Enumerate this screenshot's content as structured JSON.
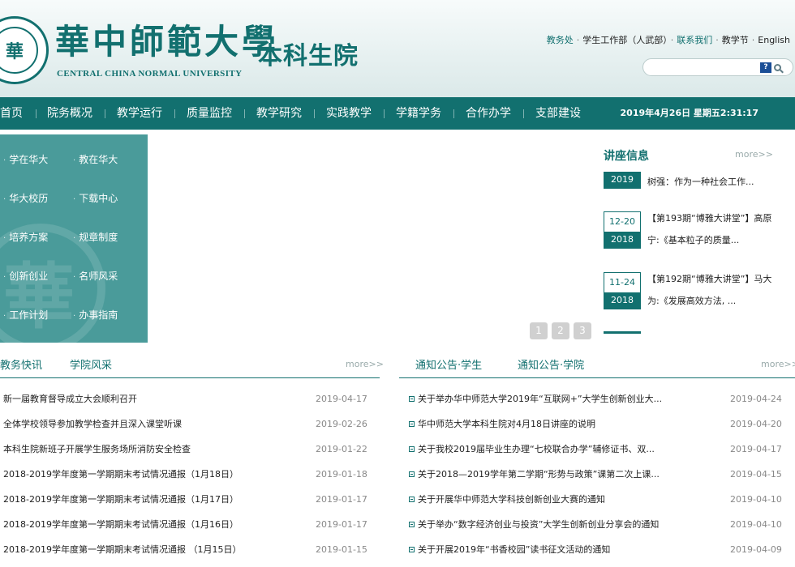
{
  "header": {
    "logo_title": "華中師範大學",
    "logo_subtitle": "CENTRAL CHINA NORMAL UNIVERSITY",
    "dept_name": "本科生院",
    "seal_glyph": "華",
    "top_links": [
      {
        "label": "教务处",
        "color": "#12706f"
      },
      {
        "label": "学生工作部（人武部）",
        "color": "#222222"
      },
      {
        "label": "联系我们",
        "color": "#12706f"
      },
      {
        "label": "教学节",
        "color": "#222222"
      },
      {
        "label": "English",
        "color": "#222222"
      }
    ],
    "separator": "·",
    "search_value": "",
    "search_button_glyph": "?"
  },
  "nav": {
    "items": [
      "首页",
      "院务概况",
      "教学运行",
      "质量监控",
      "教学研究",
      "实践教学",
      "学籍学务",
      "合作办学",
      "支部建设"
    ],
    "clock": "2019年4月26日 星期五2:31:17"
  },
  "quick_links": {
    "dot": "·",
    "items": [
      "学在华大",
      "教在华大",
      "华大校历",
      "下载中心",
      "培养方案",
      "规章制度",
      "创新创业",
      "名师风采",
      "工作计划",
      "办事指南"
    ]
  },
  "banner": {
    "pages": [
      "1",
      "2",
      "3"
    ]
  },
  "lectures": {
    "title": "讲座信息",
    "more": "more>>",
    "items": [
      {
        "md": "",
        "year": "2019",
        "text": "树强：作为一种社会工作..."
      },
      {
        "md": "12-20",
        "year": "2018",
        "text": "【第193期“博雅大讲堂”】高原宁:《基本粒子的质量..."
      },
      {
        "md": "11-24",
        "year": "2018",
        "text": "【第192期“博雅大讲堂”】马大为:《发展高效方法, ..."
      }
    ]
  },
  "left_news": {
    "tabs": [
      "教务快讯",
      "学院风采"
    ],
    "more": "more>>",
    "rows": [
      {
        "title": "新一届教育督导成立大会顺利召开",
        "date": "2019-04-17"
      },
      {
        "title": "全体学校领导参加教学检查并且深入课堂听课",
        "date": "2019-02-26"
      },
      {
        "title": "本科生院新班子开展学生服务场所消防安全检查",
        "date": "2019-01-22"
      },
      {
        "title": "2018-2019学年度第一学期期末考试情况通报（1月18日）",
        "date": "2019-01-18"
      },
      {
        "title": "2018-2019学年度第一学期期末考试情况通报（1月17日）",
        "date": "2019-01-17"
      },
      {
        "title": "2018-2019学年度第一学期期末考试情况通报（1月16日）",
        "date": "2019-01-17"
      },
      {
        "title": "2018-2019学年度第一学期期末考试情况通报 （1月15日）",
        "date": "2019-01-15"
      }
    ]
  },
  "right_news": {
    "tabs": [
      "通知公告·学生",
      "通知公告·学院"
    ],
    "more": "more>>",
    "rows": [
      {
        "title": "关于举办华中师范大学2019年“互联网+”大学生创新创业大...",
        "date": "2019-04-24"
      },
      {
        "title": "华中师范大学本科生院对4月18日讲座的说明",
        "date": "2019-04-20"
      },
      {
        "title": "关于我校2019届毕业生办理“七校联合办学”辅修证书、双...",
        "date": "2019-04-17"
      },
      {
        "title": "关于2018—2019学年第二学期“形势与政策”课第二次上课...",
        "date": "2019-04-15"
      },
      {
        "title": "关于开展华中师范大学科技创新创业大赛的通知",
        "date": "2019-04-10"
      },
      {
        "title": "关于举办“数字经济创业与投资”大学生创新创业分享会的通知",
        "date": "2019-04-10"
      },
      {
        "title": "关于开展2019年“书香校园”读书征文活动的通知",
        "date": "2019-04-09"
      }
    ]
  }
}
